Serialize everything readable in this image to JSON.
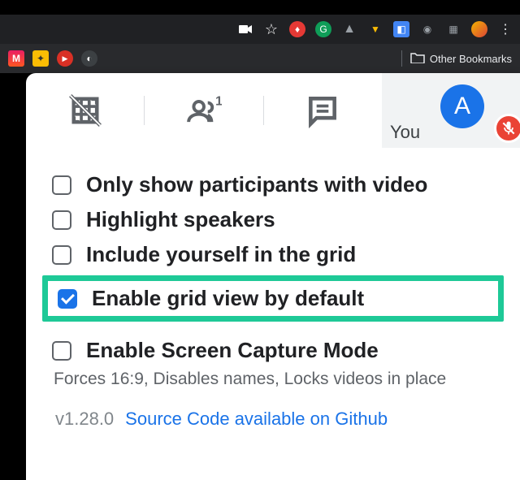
{
  "browser": {
    "other_bookmarks": "Other Bookmarks"
  },
  "tabs": {
    "you_label": "You",
    "avatar_initial": "A"
  },
  "options": {
    "only_video": "Only show participants with video",
    "highlight": "Highlight speakers",
    "include_self": "Include yourself in the grid",
    "enable_grid": "Enable grid view by default",
    "screen_capture": "Enable Screen Capture Mode",
    "screen_capture_desc": "Forces 16:9, Disables names, Locks videos in place"
  },
  "footer": {
    "version": "v1.28.0",
    "link": "Source Code available on Github"
  }
}
